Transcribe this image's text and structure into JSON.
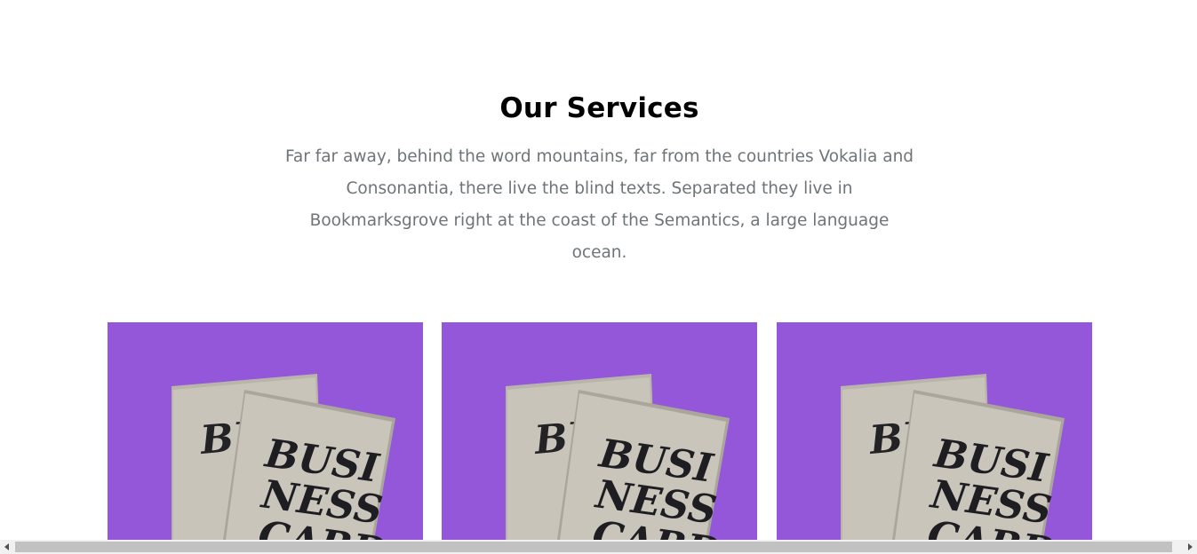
{
  "section": {
    "title": "Our Services",
    "intro": "Far far away, behind the word mountains, far from the countries Vokalia and Consonantia, there live the blind texts. Separated they live in Bookmarksgrove right at the coast of the Semantics, a large language ocean."
  },
  "cards": [
    {
      "image": "business-card-mockup",
      "background": "#9457d9",
      "card_lettering": [
        "BUSI",
        "NESS",
        "CARD"
      ]
    },
    {
      "image": "business-card-mockup",
      "background": "#9457d9",
      "card_lettering": [
        "BUSI",
        "NESS",
        "CARD"
      ]
    },
    {
      "image": "business-card-mockup",
      "background": "#9457d9",
      "card_lettering": [
        "BUSI",
        "NESS",
        "CARD"
      ]
    }
  ],
  "scrollbar": {
    "left_arrow_icon": "chevron-left-icon",
    "right_arrow_icon": "chevron-right-icon"
  }
}
